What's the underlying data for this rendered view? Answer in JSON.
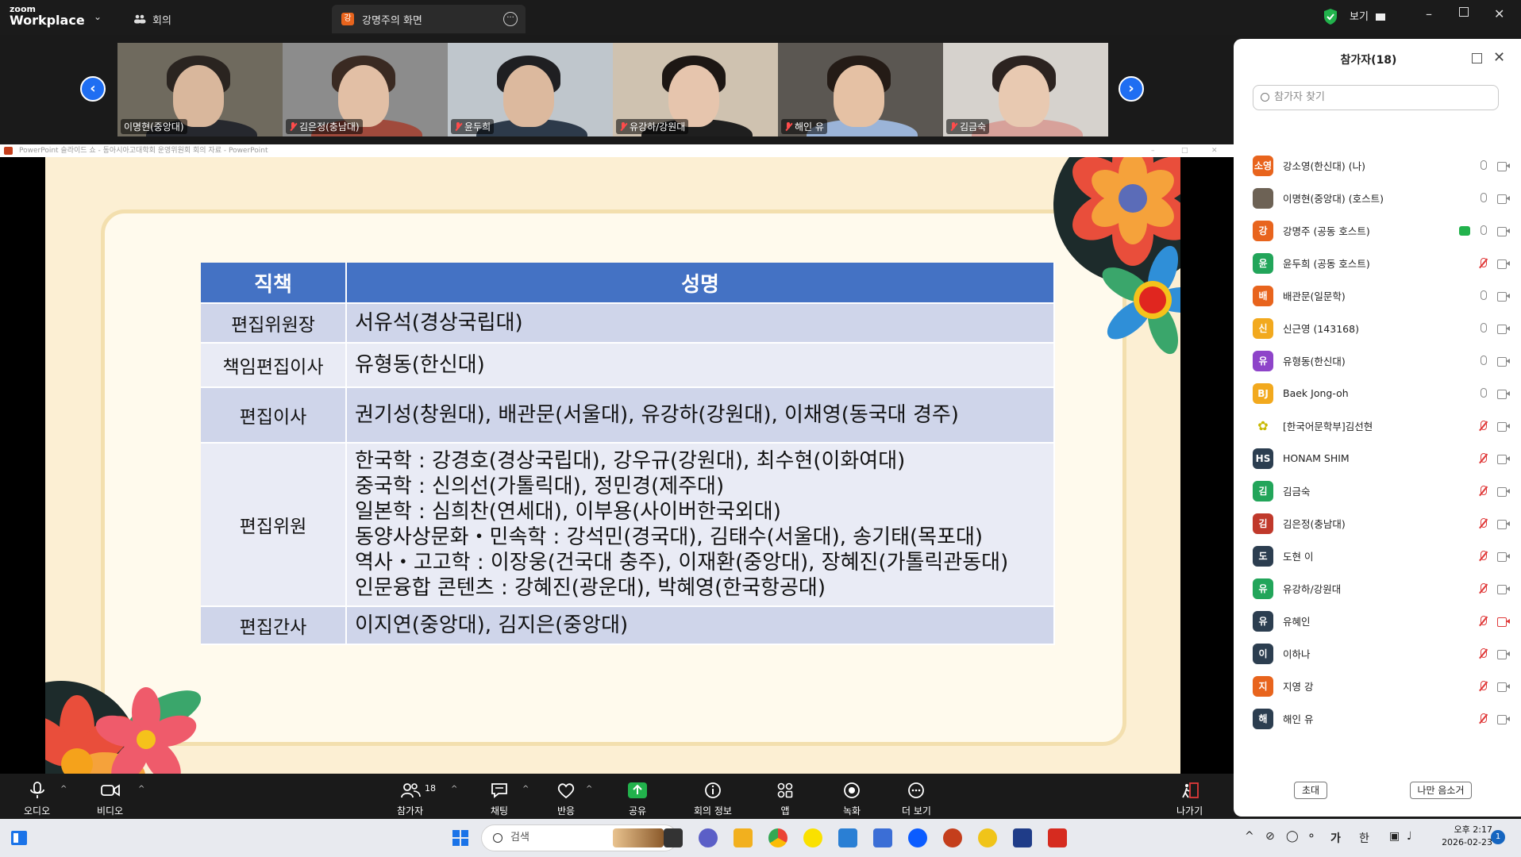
{
  "titlebar": {
    "logo_line1": "zoom",
    "logo_line2": "Workplace",
    "meeting_tab": "회의",
    "share_tab": "강명주의 화면",
    "share_badge": "강",
    "view_label": "보기"
  },
  "video_tiles": [
    {
      "name": "이명현(중앙대)",
      "muted": false,
      "bg": "#6f6a5e",
      "skin": "#d9b79c",
      "hair": "#2a2420",
      "shirt": "#26282e"
    },
    {
      "name": "김은정(충남대)",
      "muted": true,
      "bg": "#8c8c8c",
      "skin": "#e2bfa5",
      "hair": "#3a2a22",
      "shirt": "#a04a3c"
    },
    {
      "name": "윤두희",
      "muted": true,
      "bg": "#bfc6cc",
      "skin": "#dcb99e",
      "hair": "#1f1f22",
      "shirt": "#2d3a4a"
    },
    {
      "name": "유강하/강원대",
      "muted": true,
      "bg": "#cfc2b0",
      "skin": "#e6c5ad",
      "hair": "#1d1714",
      "shirt": "#1f1f1f"
    },
    {
      "name": "해인 유",
      "muted": true,
      "bg": "#5b5752",
      "skin": "#e5c1a4",
      "hair": "#241b16",
      "shirt": "#9bb4d8"
    },
    {
      "name": "김금숙",
      "muted": true,
      "bg": "#d6d2cd",
      "skin": "#e8c9b1",
      "hair": "#2c2320",
      "shirt": "#d7a19a"
    }
  ],
  "ppt_bar": {
    "title": "PowerPoint 슬라이드 쇼  -  동아시아고대학회 운영위원회 회의 자료  -  PowerPoint"
  },
  "slide_table": {
    "header_role": "직책",
    "header_name": "성명",
    "rows": [
      {
        "role": "편집위원장",
        "names": [
          "서유석(경상국립대)"
        ]
      },
      {
        "role": "책임편집이사",
        "names": [
          "유형동(한신대)"
        ]
      },
      {
        "role": "편집이사",
        "names": [
          "권기성(창원대), 배관문(서울대), 유강하(강원대), 이채영(동국대 경주)"
        ]
      },
      {
        "role": "편집위원",
        "names": [
          "한국학 : 강경호(경상국립대), 강우규(강원대), 최수현(이화여대)",
          "중국학 : 신의선(가톨릭대), 정민경(제주대)",
          "일본학 : 심희찬(연세대), 이부용(사이버한국외대)",
          "동양사상문화・민속학 : 강석민(경국대), 김태수(서울대), 송기태(목포대)",
          "역사・고고학 : 이장웅(건국대 충주), 이재환(중앙대), 장혜진(가톨릭관동대)",
          "인문융합 콘텐츠 : 강혜진(광운대), 박혜영(한국항공대)"
        ]
      },
      {
        "role": "편집간사",
        "names": [
          "이지연(중앙대), 김지은(중앙대)"
        ]
      }
    ]
  },
  "toolbar": {
    "audio": "오디오",
    "video": "비디오",
    "participants": "참가자",
    "participants_count": "18",
    "chat": "채팅",
    "reactions": "반응",
    "share": "공유",
    "meeting_info": "회의 정보",
    "apps": "앱",
    "record": "녹화",
    "more": "더 보기",
    "leave": "나가기"
  },
  "panel": {
    "title": "참가자(18)",
    "search_placeholder": "참가자 찾기",
    "participants": [
      {
        "avatar": "소영",
        "color": "#e8641d",
        "name": "강소영(한신대) (나)",
        "muted": false,
        "cam_off": false,
        "sharing": false
      },
      {
        "avatar": "",
        "color": "#6d6255",
        "name": "이명현(중앙대) (호스트)",
        "muted": false,
        "cam_off": false,
        "sharing": false,
        "photo": true
      },
      {
        "avatar": "강",
        "color": "#e8641d",
        "name": "강명주 (공동 호스트)",
        "muted": false,
        "cam_off": false,
        "sharing": true
      },
      {
        "avatar": "윤",
        "color": "#22a55a",
        "name": "윤두희 (공동 호스트)",
        "muted": true,
        "cam_off": false,
        "sharing": false
      },
      {
        "avatar": "배",
        "color": "#e8641d",
        "name": "배관문(일문학)",
        "muted": false,
        "cam_off": false,
        "sharing": false
      },
      {
        "avatar": "신",
        "color": "#f2a91e",
        "name": "신근영 (143168)",
        "muted": false,
        "cam_off": false,
        "sharing": false
      },
      {
        "avatar": "유",
        "color": "#8e44c9",
        "name": "유형동(한신대)",
        "muted": false,
        "cam_off": false,
        "sharing": false
      },
      {
        "avatar": "BJ",
        "color": "#f2a91e",
        "name": "Baek Jong-oh",
        "muted": false,
        "cam_off": false,
        "sharing": false
      },
      {
        "avatar": "",
        "color": "#ffffff",
        "name": "[한국어문학부]김선현",
        "muted": true,
        "cam_off": false,
        "sharing": false,
        "leaf": true
      },
      {
        "avatar": "HS",
        "color": "#2c3e50",
        "name": "HONAM SHIM",
        "muted": true,
        "cam_off": false,
        "sharing": false
      },
      {
        "avatar": "김",
        "color": "#22a55a",
        "name": "김금숙",
        "muted": true,
        "cam_off": false,
        "sharing": false
      },
      {
        "avatar": "김",
        "color": "#c0392b",
        "name": "김은정(충남대)",
        "muted": true,
        "cam_off": false,
        "sharing": false
      },
      {
        "avatar": "도",
        "color": "#2c3e50",
        "name": "도현 이",
        "muted": true,
        "cam_off": false,
        "sharing": false
      },
      {
        "avatar": "유",
        "color": "#22a55a",
        "name": "유강하/강원대",
        "muted": true,
        "cam_off": false,
        "sharing": false
      },
      {
        "avatar": "유",
        "color": "#2c3e50",
        "name": "유혜인",
        "muted": true,
        "cam_off": true,
        "sharing": false
      },
      {
        "avatar": "이",
        "color": "#2c3e50",
        "name": "이하나",
        "muted": true,
        "cam_off": false,
        "sharing": false
      },
      {
        "avatar": "지",
        "color": "#e8641d",
        "name": "지영 강",
        "muted": true,
        "cam_off": false,
        "sharing": false
      },
      {
        "avatar": "해",
        "color": "#2c3e50",
        "name": "해인 유",
        "muted": true,
        "cam_off": false,
        "sharing": false
      }
    ],
    "invite_label": "초대",
    "mute_me_label": "나만 음소거"
  },
  "taskbar": {
    "search_placeholder": "검색",
    "ime_label": "가",
    "lang_label": "한",
    "clock_time": "오후 2:17",
    "clock_date": "2026-02-23",
    "notification_count": "1"
  }
}
